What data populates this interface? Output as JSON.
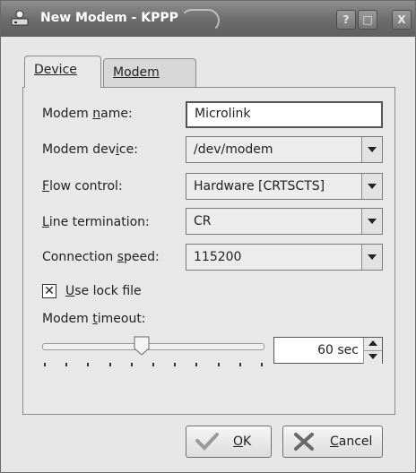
{
  "window": {
    "title": "New Modem - KPPP",
    "controls": {
      "help": "?",
      "maximize": "□",
      "close": "X"
    }
  },
  "tabs": [
    {
      "label": "Device",
      "active": true
    },
    {
      "label": "Modem",
      "active": false
    }
  ],
  "form": {
    "modem_name": {
      "label_pre": "Modem ",
      "label_u": "n",
      "label_post": "ame:",
      "value": "Microlink"
    },
    "modem_device": {
      "label_pre": "Modem dev",
      "label_u": "i",
      "label_post": "ce:",
      "value": "/dev/modem"
    },
    "flow_control": {
      "label_pre": "",
      "label_u": "F",
      "label_post": "low control:",
      "value": "Hardware [CRTSCTS]"
    },
    "line_termination": {
      "label_pre": "",
      "label_u": "L",
      "label_post": "ine termination:",
      "value": "CR"
    },
    "connection_speed": {
      "label_pre": "Connection ",
      "label_u": "s",
      "label_post": "peed:",
      "value": "115200"
    },
    "use_lock_file": {
      "label_pre": "",
      "label_u": "U",
      "label_post": "se lock file",
      "checked": true,
      "mark": "✕"
    },
    "modem_timeout": {
      "label_pre": "Modem ",
      "label_u": "t",
      "label_post": "imeout:",
      "value": "60 sec",
      "slider_fraction": 0.45
    }
  },
  "buttons": {
    "ok": {
      "u": "O",
      "rest": "K"
    },
    "cancel": {
      "u": "C",
      "rest": "ancel"
    }
  },
  "colors": {
    "titlebar": "#6e6e6e",
    "panel": "#e8e8e8",
    "ok_check": "#9a9a9a",
    "cancel_x": "#6a6a6a"
  }
}
